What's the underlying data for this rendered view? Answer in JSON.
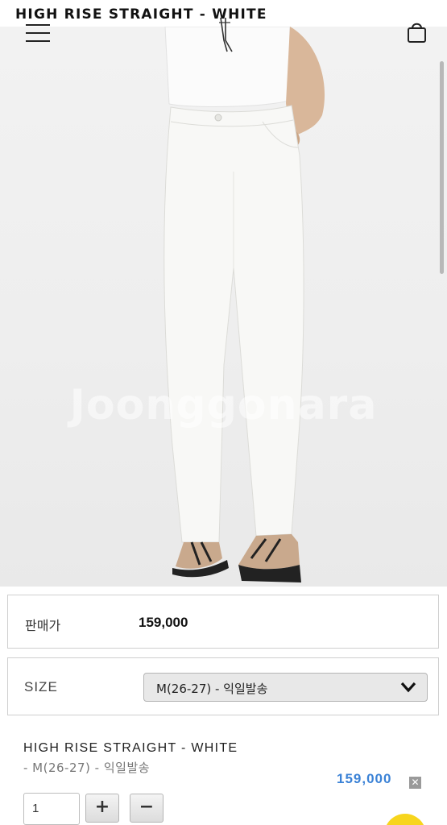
{
  "header": {
    "title": "HIGH RISE STRAIGHT - WHITE",
    "menu_icon": "hamburger-menu-icon",
    "logo_icon": "brand-logo-icon",
    "cart_icon": "shopping-bag-icon"
  },
  "hero": {
    "watermark": "Joonggonara"
  },
  "price": {
    "label": "판매가",
    "value": "159,000"
  },
  "size": {
    "label": "SIZE",
    "selected": "M(26-27) - 익일발송"
  },
  "selection": {
    "name": "HIGH RISE STRAIGHT - WHITE",
    "option": "- M(26-27) - 익일발송",
    "price": "159,000",
    "remove_label": "✕",
    "quantity": "1",
    "plus_label": "+",
    "minus_label": "−"
  },
  "colors": {
    "price_accent": "#3b82d6",
    "fab": "#f7d51d"
  }
}
